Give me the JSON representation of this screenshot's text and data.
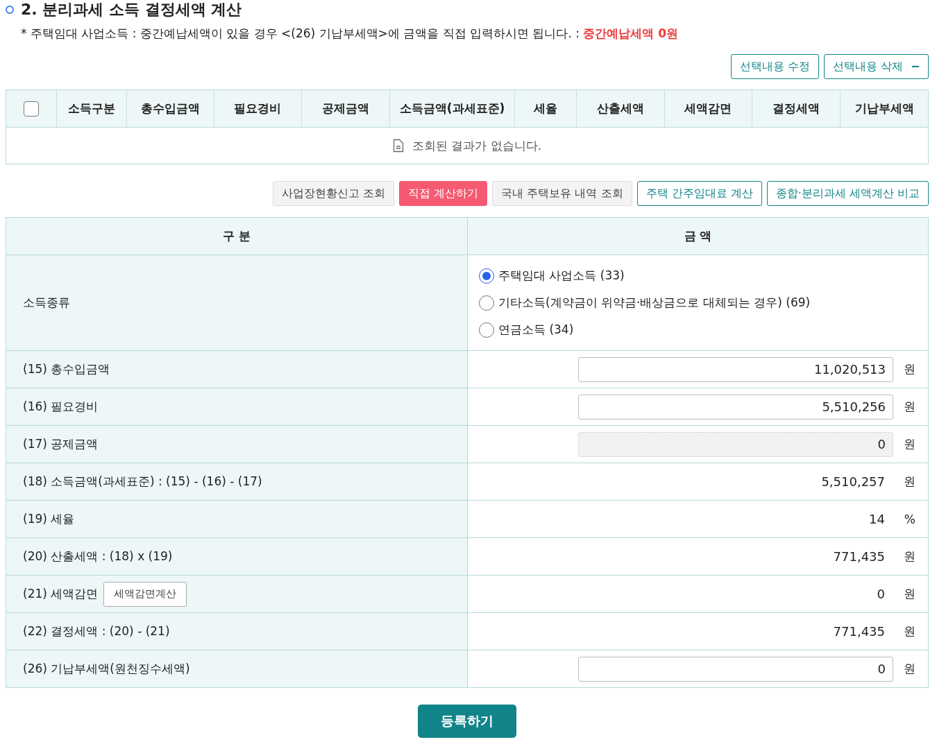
{
  "section": {
    "title": "2. 분리과세 소득 결정세액 계산",
    "note": "* 주택임대 사업소득 : 중간예납세액이 있을 경우 <(26) 기납부세액>에 금액을 직접 입력하시면 됩니다. :",
    "note_highlight": "중간예납세액 0원"
  },
  "list_actions": [
    {
      "label": "선택내용 수정",
      "kind": "plain"
    },
    {
      "label": "선택내용 삭제",
      "kind": "minus"
    }
  ],
  "list_table": {
    "select_all_checked": false,
    "columns": [
      "소득구분",
      "총수입금액",
      "필요경비",
      "공제금액",
      "소득금액(과세표준)",
      "세율",
      "산출세액",
      "세액감면",
      "결정세액",
      "기납부세액"
    ],
    "empty_message": "조회된 결과가 없습니다."
  },
  "toolbar": [
    {
      "label": "사업장현황신고 조회",
      "kind": "gray"
    },
    {
      "label": "직접 계산하기",
      "kind": "active"
    },
    {
      "label": "국내 주택보유 내역 조회",
      "kind": "gray"
    },
    {
      "label": "주택 간주임대료 계산",
      "kind": "outline"
    },
    {
      "label": "종합·분리과세 세액계산 비교",
      "kind": "outline"
    }
  ],
  "form": {
    "columns": [
      "구 분",
      "금 액"
    ],
    "rows": [
      {
        "kind": "radio",
        "label": "소득종류",
        "options": [
          {
            "label": "주택임대 사업소득 (33)",
            "selected": true
          },
          {
            "label": "기타소득(계약금이 위약금·배상금으로 대체되는 경우) (69)",
            "selected": false
          },
          {
            "label": "연금소득 (34)",
            "selected": false
          }
        ]
      },
      {
        "kind": "input",
        "label": "(15) 총수입금액",
        "value": "11,020,513",
        "unit": "원",
        "disabled": false
      },
      {
        "kind": "input",
        "label": "(16) 필요경비",
        "value": "5,510,256",
        "unit": "원",
        "disabled": false
      },
      {
        "kind": "input",
        "label": "(17) 공제금액",
        "value": "0",
        "unit": "원",
        "disabled": true
      },
      {
        "kind": "text",
        "label": "(18) 소득금액(과세표준) : (15) - (16) - (17)",
        "value": "5,510,257",
        "unit": "원"
      },
      {
        "kind": "text",
        "label": "(19) 세율",
        "value": "14",
        "unit": "%"
      },
      {
        "kind": "text",
        "label": "(20) 산출세액 : (18) x (19)",
        "value": "771,435",
        "unit": "원"
      },
      {
        "kind": "text",
        "label": "(21) 세액감면",
        "button": "세액감면계산",
        "value": "0",
        "unit": "원"
      },
      {
        "kind": "text",
        "label": "(22) 결정세액 : (20) - (21)",
        "value": "771,435",
        "unit": "원"
      },
      {
        "kind": "input",
        "label": "(26) 기납부세액(원천징수세액)",
        "value": "0",
        "unit": "원",
        "disabled": false
      }
    ]
  },
  "submit": "등록하기"
}
